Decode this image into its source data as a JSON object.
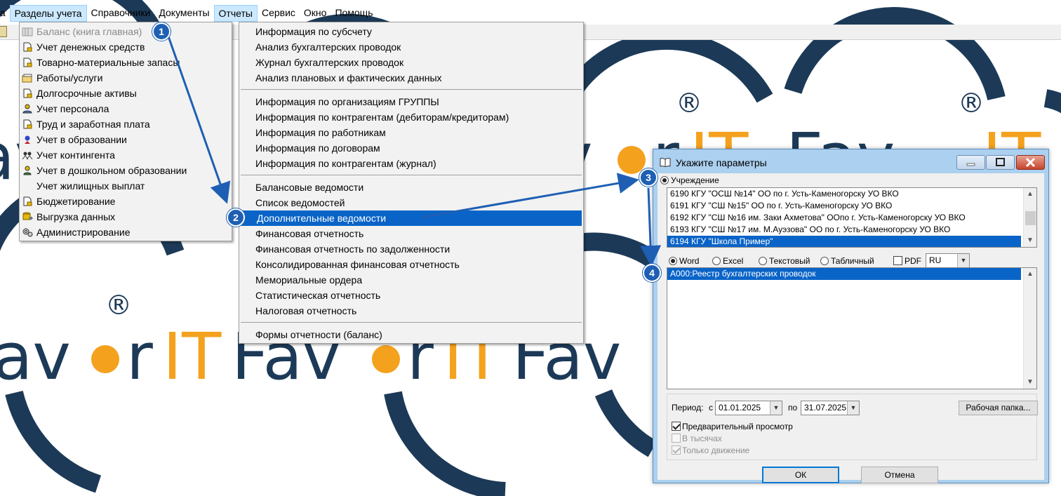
{
  "menubar": {
    "items": [
      {
        "label": "вка"
      },
      {
        "label": "Разделы учета"
      },
      {
        "label": "Справочники"
      },
      {
        "label": "Документы"
      },
      {
        "label": "Отчеты"
      },
      {
        "label": "Сервис"
      },
      {
        "label": "Окно"
      },
      {
        "label": "Помощь"
      }
    ]
  },
  "watermark": {
    "registered_mark": "®",
    "word_part1": "Fav",
    "word_part2": "r",
    "word_part3": "IT",
    "line1_full": "FavorIT FavorIT",
    "line2_full": "avorIT FavorIT Fav",
    "colors": {
      "navy": "#1c3a57",
      "orange": "#f4a11d"
    }
  },
  "sections_menu": {
    "items": [
      {
        "label": "Баланс (книга главная)",
        "icon": "ledger-icon",
        "disabled": true
      },
      {
        "label": "Учет денежных средств",
        "icon": "document-icon"
      },
      {
        "label": "Товарно-материальные запасы",
        "icon": "document-icon"
      },
      {
        "label": "Работы/услуги",
        "icon": "folder-stack-icon"
      },
      {
        "label": "Долгосрочные активы",
        "icon": "document-icon"
      },
      {
        "label": "Учет персонала",
        "icon": "person-icon"
      },
      {
        "label": "Труд и заработная плата",
        "icon": "document-icon"
      },
      {
        "label": "Учет в образовании",
        "icon": "graduate-icon"
      },
      {
        "label": "Учет контингента",
        "icon": "people-icon"
      },
      {
        "label": "Учет в дошкольном образовании",
        "icon": "child-icon"
      },
      {
        "label": "Учет жилищных выплат",
        "icon": ""
      },
      {
        "label": "Бюджетирование",
        "icon": "document-icon"
      },
      {
        "label": "Выгрузка данных",
        "icon": "db-export-icon"
      },
      {
        "label": "Администрирование",
        "icon": "gears-icon"
      }
    ]
  },
  "reports_menu": {
    "group1": [
      {
        "label": "Информация по субсчету"
      },
      {
        "label": "Анализ бухгалтерских проводок"
      },
      {
        "label": "Журнал бухгалтерских проводок"
      },
      {
        "label": "Анализ плановых и фактических данных"
      }
    ],
    "group2": [
      {
        "label": "Информация по организациям ГРУППЫ"
      },
      {
        "label": "Информация по контрагентам (дебиторам/кредиторам)"
      },
      {
        "label": "Информация по работникам"
      },
      {
        "label": "Информация по договорам"
      },
      {
        "label": "Информация по контрагентам (журнал)"
      }
    ],
    "group3": [
      {
        "label": "Балансовые ведомости"
      },
      {
        "label": "Список ведомостей"
      },
      {
        "label": "Дополнительные ведомости",
        "active": true
      },
      {
        "label": "Финансовая отчетность"
      },
      {
        "label": "Финансовая отчетность по задолженности"
      },
      {
        "label": "Консолидированная финансовая отчетность"
      },
      {
        "label": "Мемориальные ордера"
      },
      {
        "label": "Статистическая отчетность"
      },
      {
        "label": "Налоговая отчетность"
      }
    ],
    "group4": [
      {
        "label": "Формы отчетности (баланс)"
      }
    ]
  },
  "callouts": [
    "1",
    "2",
    "3",
    "4"
  ],
  "dialog": {
    "title": "Укажите параметры",
    "institution_label": "Учреждение",
    "institutions": [
      {
        "label": "6190 КГУ \"ОСШ №14\" ОО по г. Усть-Каменогорску УО ВКО"
      },
      {
        "label": "6191 КГУ \"СШ №15\" ОО по г. Усть-Каменогорску УО ВКО"
      },
      {
        "label": "6192 КГУ \"СШ №16 им. Заки Ахметова\" ООпо г. Усть-Каменогорску УО ВКО"
      },
      {
        "label": "6193 КГУ \"СШ №17 им. М.Ауэзова\" ОО по г. Усть-Каменогорску УО ВКО"
      },
      {
        "label": "6194 КГУ \"Школа Пример\"",
        "selected": true
      }
    ],
    "formats": [
      "Word",
      "Excel",
      "Текстовый",
      "Табличный"
    ],
    "format_selected": "Word",
    "pdf_label": "PDF",
    "pdf_checked": false,
    "language": "RU",
    "reports": [
      {
        "label": "A000:Реестр бухгалтерских проводок",
        "selected": true
      }
    ],
    "period_label": "Период:",
    "from_label": "с",
    "date_from": "01.01.2025",
    "to_label": "по",
    "date_to": "31.07.2025",
    "workfolder_button": "Рабочая папка...",
    "preview_label": "Предварительный просмотр",
    "preview_checked": true,
    "thousands_label": "В тысячах",
    "thousands_checked": false,
    "movement_label": "Только движение",
    "movement_checked": true,
    "ok_button": "ОК",
    "cancel_button": "Отмена"
  }
}
